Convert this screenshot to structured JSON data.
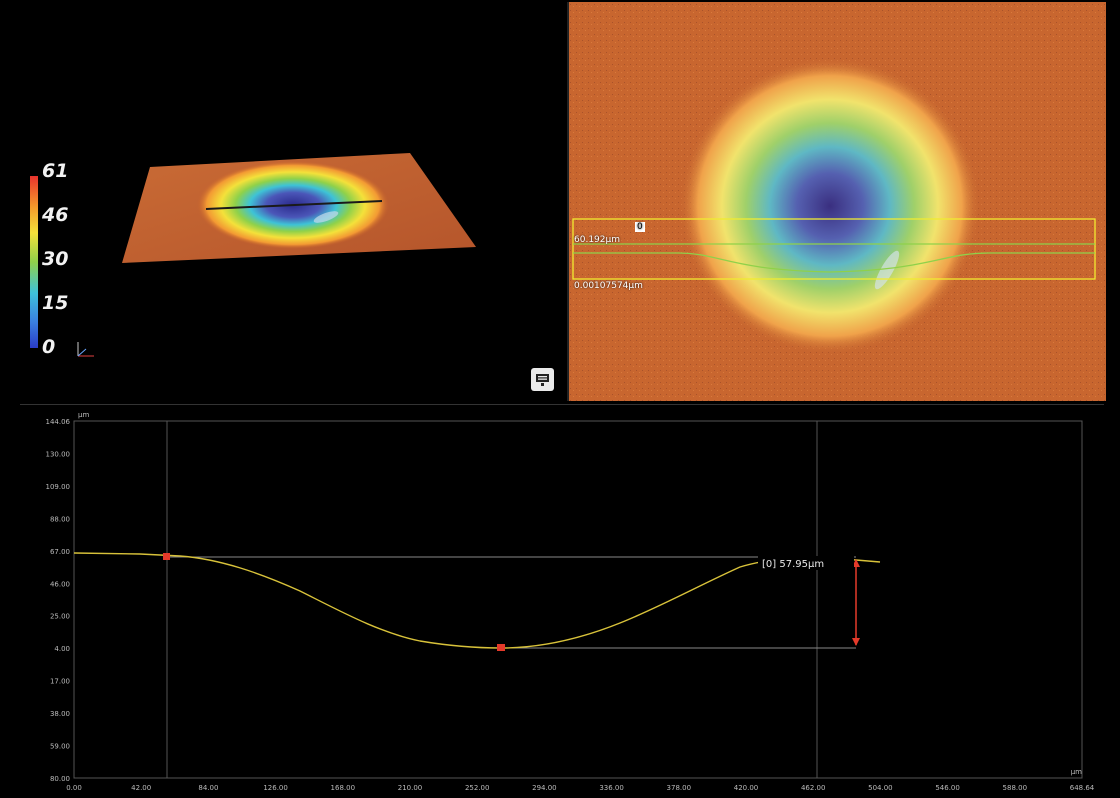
{
  "legend": {
    "labels": [
      "61",
      "46",
      "30",
      "15",
      "0"
    ]
  },
  "topview": {
    "marker_label": "0",
    "top_value": "60.192µm",
    "bottom_value": "0.00107574µm"
  },
  "profile": {
    "y_unit": "µm",
    "x_unit": "µm",
    "y_ticks": [
      "144.06",
      "130.00",
      "109.00",
      "88.00",
      "67.00",
      "46.00",
      "25.00",
      "4.00",
      "17.00",
      "38.00",
      "59.00",
      "80.00"
    ],
    "x_ticks": [
      "0.00",
      "42.00",
      "84.00",
      "126.00",
      "168.00",
      "210.00",
      "252.00",
      "294.00",
      "336.00",
      "378.00",
      "420.00",
      "462.00",
      "504.00",
      "546.00",
      "588.00",
      "648.64"
    ],
    "measurement": "[0] 57.95µm",
    "colors": {
      "curve": "#d8c23a",
      "marker": "#e53a2a",
      "grid": "#555555"
    }
  }
}
